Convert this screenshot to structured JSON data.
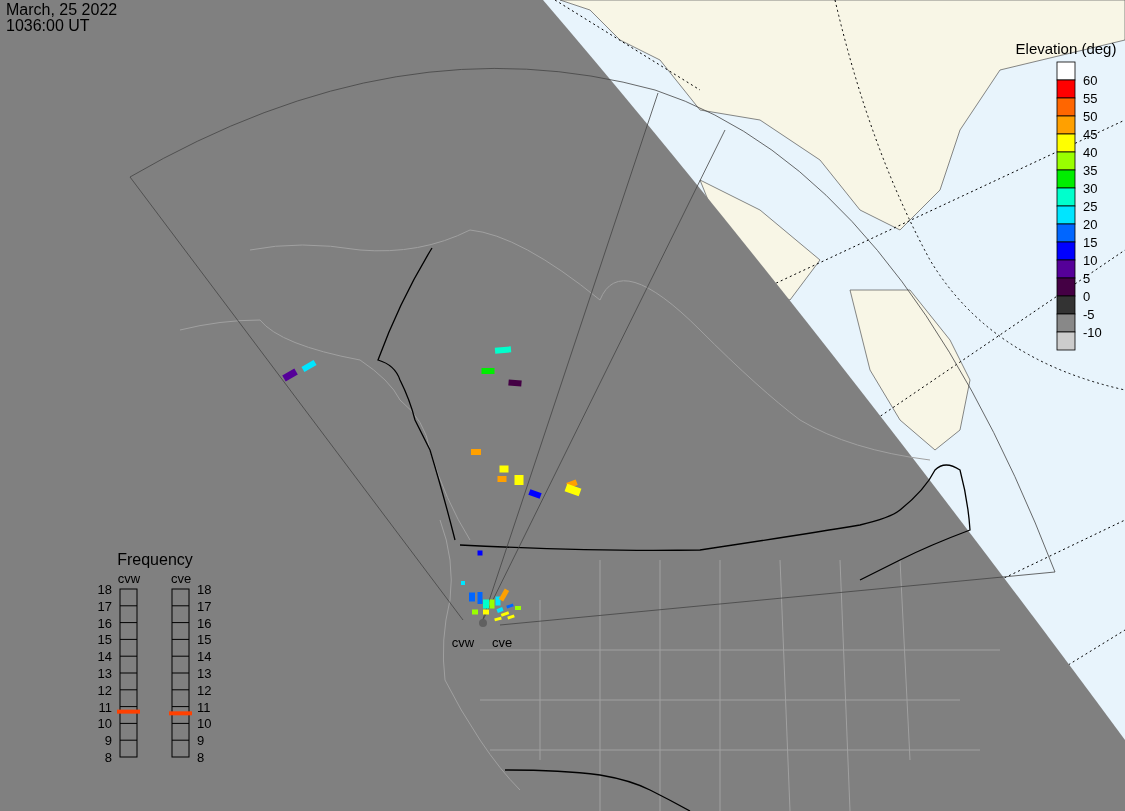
{
  "header": {
    "date": "March, 25 2022",
    "time": "1036:00 UT"
  },
  "elevation_scale": {
    "title": "Elevation (deg)",
    "cells": [
      {
        "color": "#ffffff"
      },
      {
        "color": "#ff0000"
      },
      {
        "color": "#ff6600"
      },
      {
        "color": "#ffa000"
      },
      {
        "color": "#ffff00"
      },
      {
        "color": "#99ff00"
      },
      {
        "color": "#00ee00"
      },
      {
        "color": "#00ffcc"
      },
      {
        "color": "#00e5ff"
      },
      {
        "color": "#0066ff"
      },
      {
        "color": "#0000ff"
      },
      {
        "color": "#550099"
      },
      {
        "color": "#440044"
      },
      {
        "color": "#333333"
      },
      {
        "color": "#888888"
      },
      {
        "color": "#cccccc"
      }
    ],
    "ticks": [
      "60",
      "55",
      "50",
      "45",
      "40",
      "35",
      "30",
      "25",
      "20",
      "15",
      "10",
      "5",
      "0",
      "-5",
      "-10"
    ]
  },
  "frequency": {
    "title": "Frequency",
    "radars": [
      {
        "name": "cvw",
        "level": 0.27,
        "ticks": [
          "18",
          "17",
          "16",
          "15",
          "14",
          "13",
          "12",
          "11",
          "10",
          "9",
          "8"
        ]
      },
      {
        "name": "cve",
        "level": 0.26,
        "ticks": [
          "18",
          "17",
          "16",
          "15",
          "14",
          "13",
          "12",
          "11",
          "10",
          "9",
          "8"
        ]
      }
    ]
  },
  "map": {
    "radar_labels": [
      "cvw",
      "cve"
    ]
  }
}
